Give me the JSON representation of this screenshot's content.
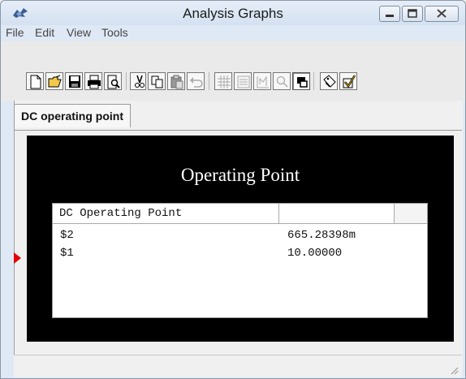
{
  "window": {
    "title": "Analysis Graphs"
  },
  "menu": {
    "items": [
      "File",
      "Edit",
      "View",
      "Tools"
    ]
  },
  "toolbar": {
    "tools": [
      "new",
      "open",
      "save",
      "print",
      "print-preview",
      "cut",
      "copy",
      "paste",
      "undo",
      "grid",
      "table",
      "graph-settings",
      "zoom",
      "overlay",
      "tag",
      "check"
    ]
  },
  "tabs": [
    "DC operating point"
  ],
  "graph": {
    "title": "Operating Point",
    "table": {
      "columns": [
        "DC Operating Point",
        "",
        ""
      ],
      "rows": [
        [
          "$2",
          "665.28398m"
        ],
        [
          "$1",
          "10.00000"
        ]
      ]
    }
  }
}
